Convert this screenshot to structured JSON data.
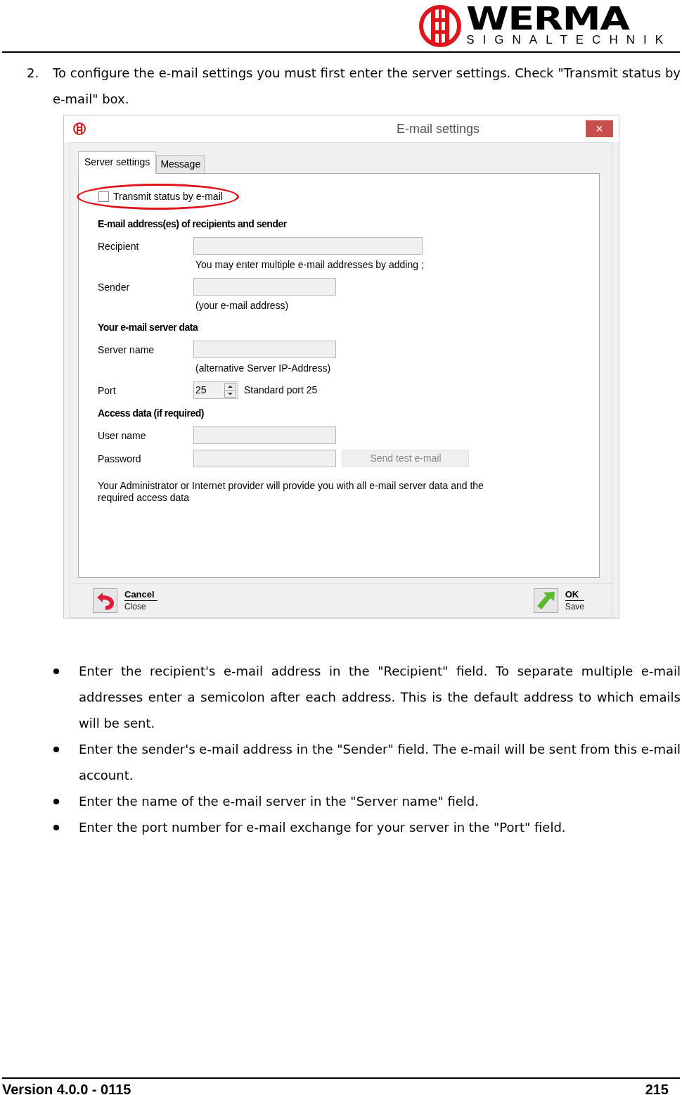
{
  "header": {
    "logo_word": "WERMA",
    "logo_sub": "SIGNALTECHNIK"
  },
  "step": {
    "number": "2.",
    "text": "To configure the e-mail settings you must first enter the server settings. Check \"Transmit status by e-mail\" box."
  },
  "dialog": {
    "title": "E-mail settings",
    "close": "×",
    "tabs": [
      {
        "label": "Server settings",
        "selected": true
      },
      {
        "label": "Message",
        "selected": false
      }
    ],
    "transmit": {
      "label": "Transmit status by e-mail",
      "checked": false
    },
    "sections": [
      {
        "heading": "E-mail address(es) of recipients and sender",
        "rows": [
          {
            "kind": "wide_field",
            "label": "Recipient",
            "hint": "You may enter multiple e-mail addresses by adding ;"
          },
          {
            "kind": "field",
            "label": "Sender",
            "hint": "(your e-mail address)"
          }
        ]
      },
      {
        "heading": "Your e-mail server data",
        "rows": [
          {
            "kind": "field",
            "label": "Server name",
            "hint": "(alternative Server IP-Address)"
          },
          {
            "kind": "spinner",
            "label": "Port",
            "value": "25",
            "note": "Standard port 25"
          }
        ]
      },
      {
        "heading": "Access data (if required)",
        "rows": [
          {
            "kind": "field",
            "label": "User name"
          },
          {
            "kind": "field",
            "label": "Password",
            "button": {
              "label": "Send test e-mail",
              "disabled": true
            }
          }
        ]
      }
    ],
    "note": "Your Administrator or Internet provider will provide you with all e-mail server data and the required access data",
    "cancel": {
      "title": "Cancel",
      "subtitle": "Close"
    },
    "ok": {
      "title": "OK",
      "subtitle": "Save"
    }
  },
  "bullets": [
    "Enter the recipient's e-mail address in the \"Recipient\" field. To separate multiple e-mail addresses enter a semicolon after each address.  This is the default address to which emails will be sent.",
    "Enter the sender's e-mail address in the \"Sender\" field. The e-mail will be sent from this e-mail account.",
    "Enter the name of the e-mail server in the \"Server name\" field.",
    "Enter the port number for e-mail exchange for your server in the \"Port\" field."
  ],
  "footer": {
    "version": "Version 4.0.0 - 0115",
    "page": "215"
  }
}
